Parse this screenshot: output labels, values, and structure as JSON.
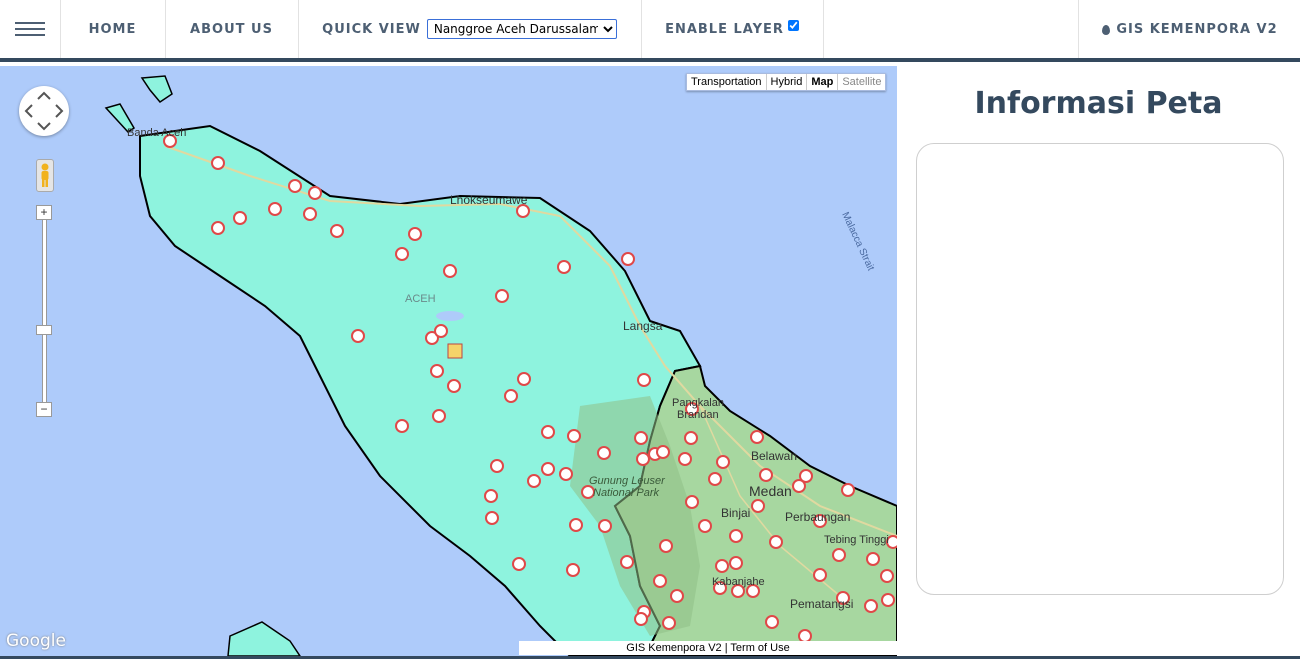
{
  "nav": {
    "home": "HOME",
    "about": "ABOUT US",
    "quick_view_label": "QUICK VIEW",
    "quick_view_value": "Nanggroe Aceh Darussalam",
    "enable_layer_label": "ENABLE LAYER",
    "enable_layer_checked": true,
    "brand": "GIS KEMENPORA V2"
  },
  "map": {
    "types": [
      "Transportation",
      "Hybrid",
      "Map",
      "Satellite"
    ],
    "active_type": "Map",
    "labels": {
      "banda": "Banda Aceh",
      "lhokseumawe": "Lhokseumawe",
      "aceh": "ACEH",
      "langsa": "Langsa",
      "pangkalan": "Pangkalan",
      "brandan": "Brandan",
      "belawan": "Belawan",
      "medan": "Medan",
      "binjai": "Binjai",
      "perbaungan": "Perbaungan",
      "tebing": "Tebing Tinggi",
      "pematang": "Pematangsi",
      "leuser1": "Gunung Leuser",
      "leuser2": "National Park",
      "malacca": "Malacca Strait",
      "kabanjahe": "Kabanjahe"
    },
    "google": "Google",
    "footer": "GIS Kemenpora V2 | Term of Use",
    "zoom_in": "+",
    "zoom_out": "−"
  },
  "panel": {
    "title": "Informasi Peta"
  }
}
